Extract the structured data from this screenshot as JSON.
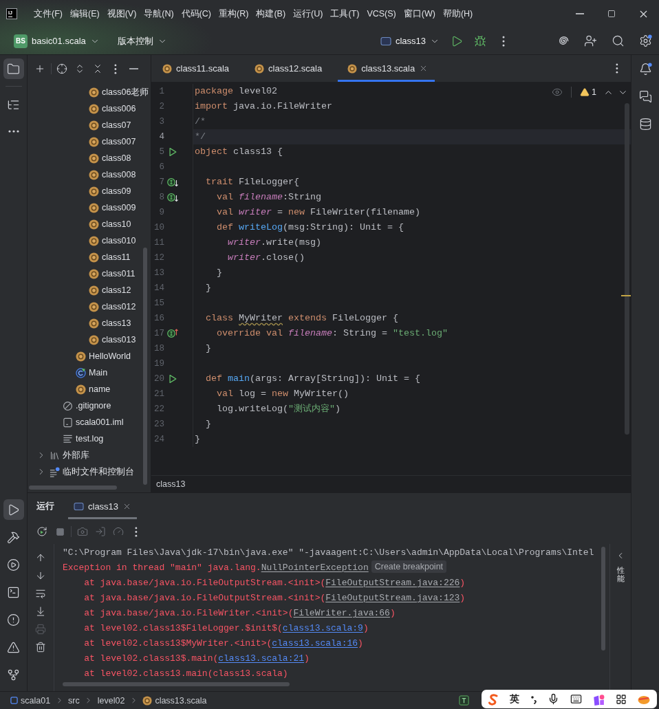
{
  "title_bar": {
    "logo": "IJ",
    "menu": [
      "文件(F)",
      "编辑(E)",
      "视图(V)",
      "导航(N)",
      "代码(C)",
      "重构(R)",
      "构建(B)",
      "运行(U)",
      "工具(T)",
      "VCS(S)",
      "窗口(W)",
      "帮助(H)"
    ]
  },
  "main_toolbar": {
    "project_badge": "BS",
    "project_name": "basic01.scala",
    "vcs_label": "版本控制",
    "run_configuration": "class13"
  },
  "left_stripe": {
    "top": [
      {
        "kind": "project",
        "selected": true
      },
      {
        "kind": "structure",
        "selected": false
      },
      {
        "kind": "more",
        "selected": false
      }
    ],
    "bottom": [
      {
        "kind": "run",
        "selected": true
      },
      {
        "kind": "build",
        "selected": false
      },
      {
        "kind": "services",
        "selected": false
      },
      {
        "kind": "terminal",
        "selected": false
      },
      {
        "kind": "problems",
        "selected": false
      },
      {
        "kind": "warnings",
        "selected": false
      },
      {
        "kind": "git",
        "selected": false
      }
    ]
  },
  "project_panel": {
    "tree": [
      {
        "children": [
          {
            "children": [
              {
                "children": [
                  {
                    "label": "class06老师",
                    "kind": "object"
                  },
                  {
                    "label": "class006",
                    "kind": "object"
                  },
                  {
                    "label": "class07",
                    "kind": "object"
                  },
                  {
                    "label": "class007",
                    "kind": "object"
                  },
                  {
                    "label": "class08",
                    "kind": "object"
                  },
                  {
                    "label": "class008",
                    "kind": "object"
                  },
                  {
                    "label": "class09",
                    "kind": "object"
                  },
                  {
                    "label": "class009",
                    "kind": "object"
                  },
                  {
                    "label": "class10",
                    "kind": "object"
                  },
                  {
                    "label": "class010",
                    "kind": "object"
                  },
                  {
                    "label": "class11",
                    "kind": "object"
                  },
                  {
                    "label": "class011",
                    "kind": "object"
                  },
                  {
                    "label": "class12",
                    "kind": "object"
                  },
                  {
                    "label": "class012",
                    "kind": "object"
                  },
                  {
                    "label": "class13",
                    "kind": "object"
                  },
                  {
                    "label": "class013",
                    "kind": "object"
                  }
                ]
              },
              {
                "label": "HelloWorld",
                "kind": "object"
              },
              {
                "label": "Main",
                "kind": "app"
              },
              {
                "label": "name",
                "kind": "object"
              }
            ]
          },
          {
            "label": ".gitignore",
            "kind": "ignore"
          },
          {
            "label": "scala001.iml",
            "kind": "module-file"
          },
          {
            "label": "test.log",
            "kind": "text"
          }
        ]
      },
      {
        "label": "外部库",
        "kind": "library",
        "expanded": false
      },
      {
        "label": "临时文件和控制台",
        "kind": "scratch",
        "expanded": false
      }
    ]
  },
  "editor": {
    "tabs": [
      {
        "label": "class11.scala",
        "selected": false
      },
      {
        "label": "class12.scala",
        "selected": false
      },
      {
        "label": "class13.scala",
        "selected": true
      }
    ],
    "warning_count": "1",
    "lines": [
      {
        "number": "1",
        "kind": "plain",
        "current": false,
        "tokens": [
          {
            "kind": "keyword",
            "text": "package"
          },
          {
            "kind": "plain",
            "text": " level02"
          }
        ]
      },
      {
        "number": "2",
        "kind": "plain",
        "current": false,
        "tokens": [
          {
            "kind": "keyword",
            "text": "import"
          },
          {
            "kind": "plain",
            "text": " java.io.FileWriter"
          }
        ]
      },
      {
        "number": "3",
        "kind": "plain",
        "current": false,
        "tokens": [
          {
            "kind": "comment",
            "text": "/*"
          }
        ]
      },
      {
        "number": "4",
        "kind": "plain",
        "current": true,
        "tokens": [
          {
            "kind": "comment",
            "text": "*/"
          }
        ]
      },
      {
        "number": "5",
        "kind": "run",
        "current": false,
        "tokens": [
          {
            "kind": "keyword",
            "text": "object"
          },
          {
            "kind": "plain",
            "text": " class13 {"
          }
        ]
      },
      {
        "number": "6",
        "kind": "plain",
        "current": false
      },
      {
        "number": "7",
        "kind": "implemented",
        "current": false,
        "tokens": [
          {
            "kind": "keyword",
            "text": "  trait"
          },
          {
            "kind": "plain",
            "text": " FileLogger{"
          }
        ]
      },
      {
        "number": "8",
        "kind": "implemented",
        "current": false,
        "tokens": [
          {
            "kind": "keyword",
            "text": "    val "
          },
          {
            "kind": "field",
            "text": "filename"
          },
          {
            "kind": "plain",
            "text": ":String"
          }
        ]
      },
      {
        "number": "9",
        "kind": "plain",
        "current": false,
        "tokens": [
          {
            "kind": "keyword",
            "text": "    val "
          },
          {
            "kind": "field",
            "text": "writer"
          },
          {
            "kind": "plain",
            "text": " = "
          },
          {
            "kind": "keyword",
            "text": "new"
          },
          {
            "kind": "plain",
            "text": " FileWriter(filename)"
          }
        ]
      },
      {
        "number": "10",
        "kind": "plain",
        "current": false,
        "tokens": [
          {
            "kind": "keyword",
            "text": "    def "
          },
          {
            "kind": "function",
            "text": "writeLog"
          },
          {
            "kind": "plain",
            "text": "(msg:String): Unit = {"
          }
        ]
      },
      {
        "number": "11",
        "kind": "plain",
        "current": false,
        "tokens": [
          {
            "kind": "field",
            "text": "      writer"
          },
          {
            "kind": "plain",
            "text": ".write(msg)"
          }
        ]
      },
      {
        "number": "12",
        "kind": "plain",
        "current": false,
        "tokens": [
          {
            "kind": "field",
            "text": "      writer"
          },
          {
            "kind": "plain",
            "text": ".close()"
          }
        ]
      },
      {
        "number": "13",
        "kind": "plain",
        "current": false,
        "tokens": [
          {
            "kind": "plain",
            "text": "    }"
          }
        ]
      },
      {
        "number": "14",
        "kind": "plain",
        "current": false,
        "tokens": [
          {
            "kind": "plain",
            "text": "  }"
          }
        ]
      },
      {
        "number": "15",
        "kind": "plain",
        "current": false
      },
      {
        "number": "16",
        "kind": "plain",
        "current": false,
        "tokens": [
          {
            "kind": "keyword",
            "text": "  class "
          },
          {
            "kind": "warned",
            "text": "MyWriter"
          },
          {
            "kind": "keyword",
            "text": " extends"
          },
          {
            "kind": "plain",
            "text": " FileLogger {"
          }
        ]
      },
      {
        "number": "17",
        "kind": "overriding",
        "current": false,
        "tokens": [
          {
            "kind": "keyword",
            "text": "    override val "
          },
          {
            "kind": "field",
            "text": "filename"
          },
          {
            "kind": "plain",
            "text": ": String = "
          },
          {
            "kind": "string",
            "text": "\"test.log\""
          }
        ]
      },
      {
        "number": "18",
        "kind": "plain",
        "current": false,
        "tokens": [
          {
            "kind": "plain",
            "text": "  }"
          }
        ]
      },
      {
        "number": "19",
        "kind": "plain",
        "current": false
      },
      {
        "number": "20",
        "kind": "run",
        "current": false,
        "tokens": [
          {
            "kind": "keyword",
            "text": "  def "
          },
          {
            "kind": "function",
            "text": "main"
          },
          {
            "kind": "plain",
            "text": "(args: Array[String]): Unit = {"
          }
        ]
      },
      {
        "number": "21",
        "kind": "plain",
        "current": false,
        "tokens": [
          {
            "kind": "keyword",
            "text": "    val"
          },
          {
            "kind": "plain",
            "text": " log = "
          },
          {
            "kind": "keyword",
            "text": "new"
          },
          {
            "kind": "plain",
            "text": " MyWriter()"
          }
        ]
      },
      {
        "number": "22",
        "kind": "plain",
        "current": false,
        "tokens": [
          {
            "kind": "plain",
            "text": "    log.writeLog("
          },
          {
            "kind": "string",
            "text": "\"测试内容\""
          },
          {
            "kind": "plain",
            "text": ")"
          }
        ]
      },
      {
        "number": "23",
        "kind": "plain",
        "current": false,
        "tokens": [
          {
            "kind": "plain",
            "text": "  }"
          }
        ]
      },
      {
        "number": "24",
        "kind": "plain",
        "current": false,
        "tokens": [
          {
            "kind": "plain",
            "text": "}"
          }
        ]
      }
    ],
    "breadcrumb": "class13"
  },
  "run_panel": {
    "title": "运行",
    "tabs": [
      {
        "label": "class13",
        "selected": true
      }
    ],
    "side_tab": "性能",
    "console": [
      {
        "segments": [
          {
            "kind": "plain",
            "text": "\"C:\\Program Files\\Java\\jdk-17\\bin\\java.exe\" \"-javaagent:C:\\Users\\admin\\AppData\\Local\\Programs\\Intel"
          }
        ]
      },
      {
        "segments": [
          {
            "kind": "error",
            "text": "Exception in thread \"main\" java.lang."
          },
          {
            "kind": "lib-link",
            "text": "NullPointerException"
          },
          {
            "kind": "hint",
            "text": "Create breakpoint"
          }
        ]
      },
      {
        "segments": [
          {
            "kind": "error",
            "text": "    at java.base/java.io.FileOutputStream.<init>("
          },
          {
            "kind": "lib-link",
            "text": "FileOutputStream.java:226"
          },
          {
            "kind": "error",
            "text": ")"
          }
        ]
      },
      {
        "segments": [
          {
            "kind": "error",
            "text": "    at java.base/java.io.FileOutputStream.<init>("
          },
          {
            "kind": "lib-link",
            "text": "FileOutputStream.java:123"
          },
          {
            "kind": "error",
            "text": ")"
          }
        ]
      },
      {
        "segments": [
          {
            "kind": "error",
            "text": "    at java.base/java.io.FileWriter.<init>("
          },
          {
            "kind": "lib-link",
            "text": "FileWriter.java:66"
          },
          {
            "kind": "error",
            "text": ")"
          }
        ]
      },
      {
        "segments": [
          {
            "kind": "error",
            "text": "    at level02.class13$FileLogger.$init$("
          },
          {
            "kind": "link",
            "text": "class13.scala:9"
          },
          {
            "kind": "error",
            "text": ")"
          }
        ]
      },
      {
        "segments": [
          {
            "kind": "error",
            "text": "    at level02.class13$MyWriter.<init>("
          },
          {
            "kind": "link",
            "text": "class13.scala:16"
          },
          {
            "kind": "error",
            "text": ")"
          }
        ]
      },
      {
        "segments": [
          {
            "kind": "error",
            "text": "    at level02.class13$.main("
          },
          {
            "kind": "link",
            "text": "class13.scala:21"
          },
          {
            "kind": "error",
            "text": ")"
          }
        ]
      },
      {
        "segments": [
          {
            "kind": "error",
            "text": "    at level02.class13.main(class13.scala)"
          }
        ]
      }
    ]
  },
  "right_stripe": {
    "tools": [
      {
        "kind": "notifications",
        "selected": false
      },
      {
        "kind": "ai-chat",
        "selected": false
      },
      {
        "kind": "database",
        "selected": false
      }
    ]
  },
  "status_bar": {
    "path": [
      {
        "label": "scala01",
        "kind": "module"
      },
      {
        "label": "src",
        "kind": "folder"
      },
      {
        "label": "level02",
        "kind": "folder"
      },
      {
        "label": "class13.scala",
        "kind": "object"
      }
    ]
  },
  "ime_bar": {
    "mode": "英"
  }
}
